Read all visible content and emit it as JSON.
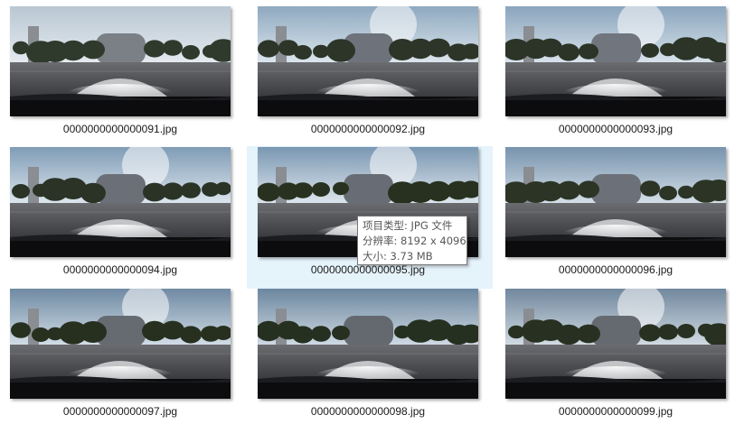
{
  "files": [
    {
      "name": "0000000000000091.jpg",
      "selected": false
    },
    {
      "name": "0000000000000092.jpg",
      "selected": false
    },
    {
      "name": "0000000000000093.jpg",
      "selected": false
    },
    {
      "name": "0000000000000094.jpg",
      "selected": false
    },
    {
      "name": "0000000000000095.jpg",
      "selected": true
    },
    {
      "name": "0000000000000096.jpg",
      "selected": false
    },
    {
      "name": "0000000000000097.jpg",
      "selected": false
    },
    {
      "name": "0000000000000098.jpg",
      "selected": false
    },
    {
      "name": "0000000000000099.jpg",
      "selected": false
    }
  ],
  "tooltip": {
    "type_line": "项目类型: JPG 文件",
    "resolution_line": "分辨率: 8192 x 4096",
    "size_line": "大小: 3.73 MB"
  },
  "colors": {
    "selection_bg": "#e5f3fb",
    "tooltip_border": "#767676"
  }
}
